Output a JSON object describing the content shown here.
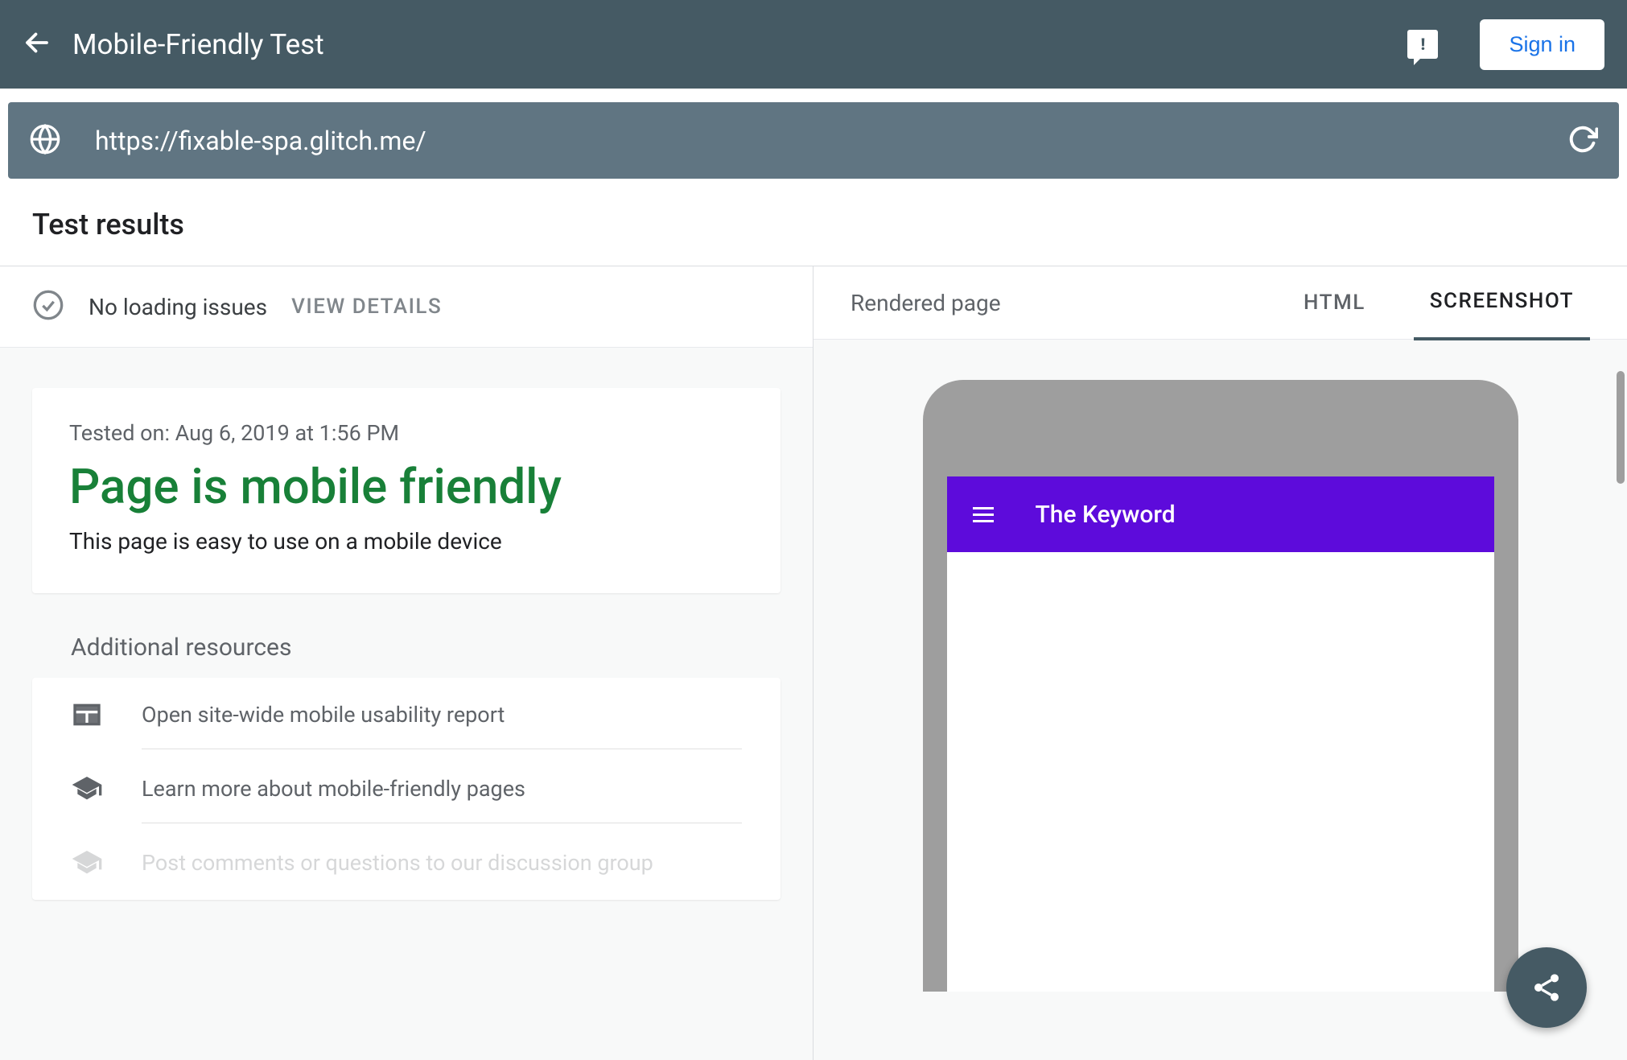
{
  "header": {
    "title": "Mobile-Friendly Test",
    "signin_label": "Sign in"
  },
  "url_bar": {
    "url": "https://fixable-spa.glitch.me/"
  },
  "results": {
    "heading": "Test results",
    "loading_status": "No loading issues",
    "view_details_label": "VIEW DETAILS",
    "tested_on": "Tested on: Aug 6, 2019 at 1:56 PM",
    "headline": "Page is mobile friendly",
    "subtitle": "This page is easy to use on a mobile device"
  },
  "additional": {
    "title": "Additional resources",
    "items": [
      "Open site-wide mobile usability report",
      "Learn more about mobile-friendly pages",
      "Post comments or questions to our discussion group"
    ]
  },
  "right": {
    "rendered_label": "Rendered page",
    "tabs": {
      "html": "HTML",
      "screenshot": "SCREENSHOT"
    }
  },
  "phone": {
    "title": "The Keyword"
  }
}
